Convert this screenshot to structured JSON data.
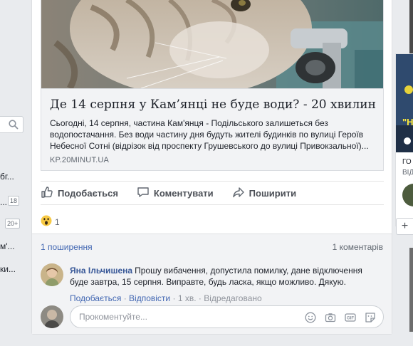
{
  "left_sidebar": {
    "fragments": [
      {
        "text": "бг...",
        "badge": ""
      },
      {
        "text": "...",
        "badge": "18"
      },
      {
        "text": "",
        "badge": "20+"
      },
      {
        "text": "м'...",
        "badge": ""
      },
      {
        "text": "ки...",
        "badge": ""
      }
    ]
  },
  "post": {
    "link": {
      "title": "Де 14 серпня у Кам’янці не буде води? - 20 хвилин",
      "description": "Сьогодні, 14 серпня, частина Кам'янця - Подільського залишеться без водопостачання. Без води частину дня будуть жителі будинків по вулиці Героїв Небесної Сотні (відрізок від проспекту Грушевського до вулиці Привокзальної)...",
      "domain": "KP.20MINUT.UA"
    },
    "actions": {
      "like": "Подобається",
      "comment": "Коментувати",
      "share": "Поширити"
    },
    "reactions": {
      "count": "1"
    },
    "stats": {
      "shares": "1 поширення",
      "comments": "1 коментарів"
    },
    "comment": {
      "author": "Яна Ільчишена",
      "text": "Прошу вибачення, допустила помилку, дане відключення буде завтра, 15 серпня. Виправте, будь ласка, якщо можливо. Дякую.",
      "like_label": "Подобається",
      "reply_label": "Відповісти",
      "time": "1 хв.",
      "edited": "Відредаговано",
      "separator": "·"
    },
    "reply": {
      "placeholder": "Прокоментуйте..."
    }
  },
  "right_column": {
    "image_text": "\"Н",
    "frag_1": "ГО",
    "frag_2": "ВІД",
    "plus": "+"
  },
  "colors": {
    "link_blue": "#4267b2",
    "author_blue": "#385898",
    "meta_gray": "#90949c",
    "action_gray": "#4b4f56",
    "background": "#e9ebee"
  }
}
